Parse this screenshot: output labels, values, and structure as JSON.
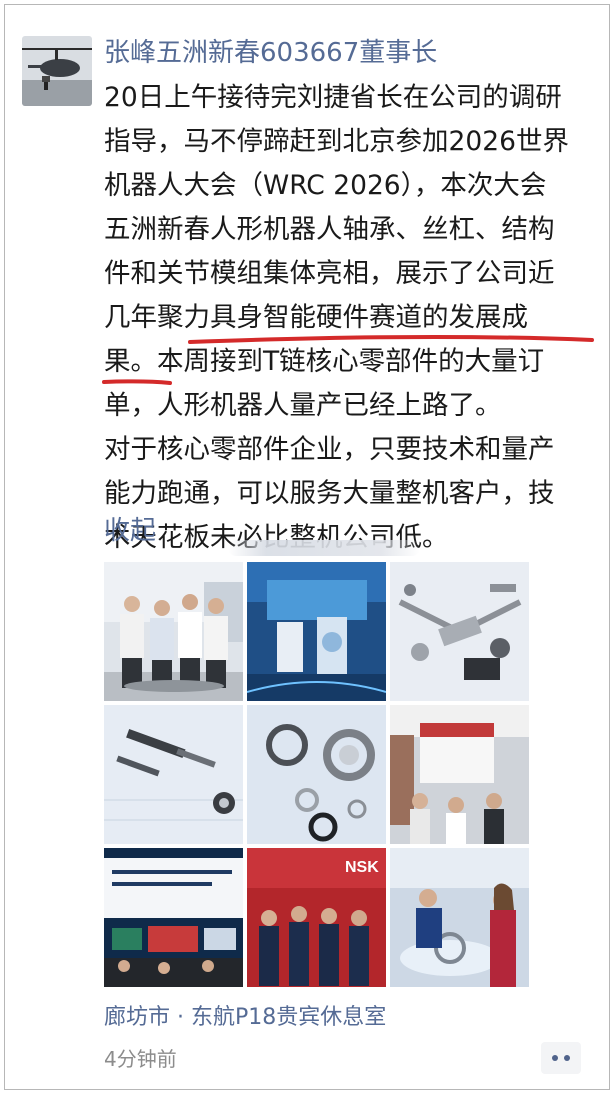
{
  "post": {
    "author": "张峰五洲新春603667董事长",
    "paragraph_1": [
      "20日上午接待完刘捷省长在公司的调研",
      "指导，马不停蹄赶到北京参加2026世界",
      "机器人大会（WRC 2026），本次大会",
      "五洲新春人形机器人轴承、丝杠、结构",
      "件和关节模组集体亮相，展示了公司近",
      "几年聚力具身智能硬件赛道的发展成",
      "果。本周接到T链核心零部件的大量订",
      "单，人形机器人量产已经上路了。"
    ],
    "paragraph_2": [
      "对于核心零部件企业，只要技术和量产",
      "能力跑通，可以服务大量整机客户，技",
      "术天花板未必比整机公司低。"
    ],
    "collapse_label": "收起",
    "location": "廊坊市 · 东航P18贵宾休息室",
    "time_ago": "4分钟前",
    "photo_signs": {
      "photo_8_sign": "NSK"
    }
  },
  "colors": {
    "link": "#556b95",
    "text": "#1a1a1a",
    "timestamp": "#8c8c8c",
    "underline": "#d42a2a"
  },
  "icons": {
    "more": "more-dots-icon",
    "avatar": "helicopter-avatar"
  }
}
